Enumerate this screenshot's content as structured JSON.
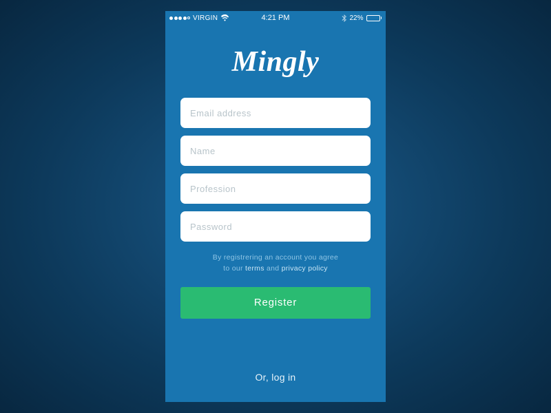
{
  "status": {
    "carrier": "VIRGIN",
    "time": "4:21 PM",
    "battery_pct": "22%"
  },
  "logo": "Mingly",
  "form": {
    "email_placeholder": "Email address",
    "name_placeholder": "Name",
    "profession_placeholder": "Profession",
    "password_placeholder": "Password"
  },
  "terms": {
    "line1": "By registrering an account you agree",
    "prefix2": "to our ",
    "terms_link": "terms",
    "mid": " and ",
    "privacy_link": "privacy policy"
  },
  "register_label": "Register",
  "login_label": "Or, log in"
}
